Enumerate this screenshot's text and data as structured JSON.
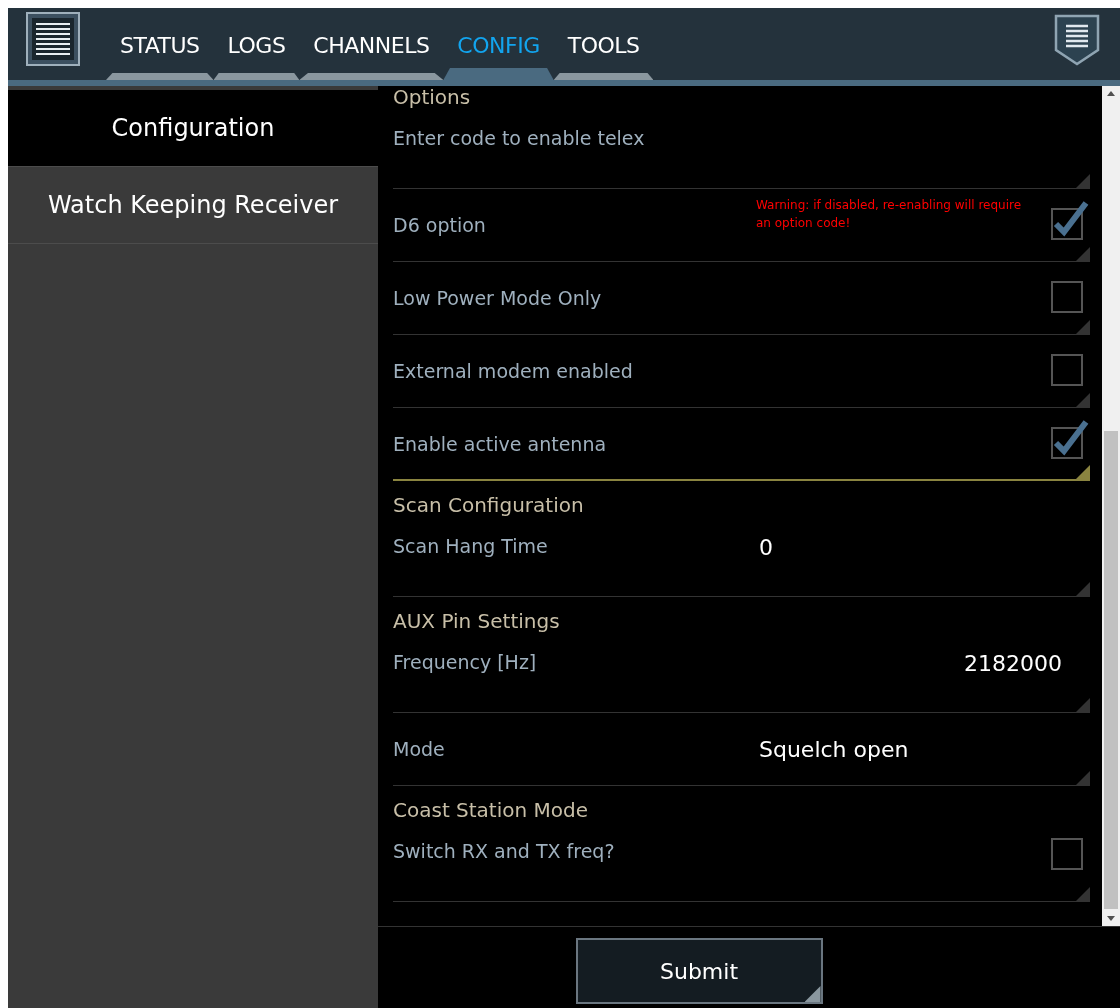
{
  "tabs": [
    {
      "label": "STATUS",
      "selected": false
    },
    {
      "label": "LOGS",
      "selected": false
    },
    {
      "label": "CHANNELS",
      "selected": false
    },
    {
      "label": "CONFIG",
      "selected": true
    },
    {
      "label": "TOOLS",
      "selected": false
    }
  ],
  "sidebar": {
    "items": [
      {
        "label": "Configuration",
        "selected": true
      },
      {
        "label": "Watch Keeping Receiver",
        "selected": false
      }
    ]
  },
  "rows": [
    {
      "kind": "section",
      "label": "Options"
    },
    {
      "kind": "input",
      "label": "Enter code to enable telex",
      "focused": false
    },
    {
      "kind": "checkbox",
      "label": "D6 option",
      "checked": true,
      "warning": "Warning: if disabled, re-enabling will require an option code!",
      "focused": false
    },
    {
      "kind": "checkbox",
      "label": "Low Power Mode Only",
      "checked": false,
      "focused": false
    },
    {
      "kind": "checkbox",
      "label": "External modem enabled",
      "checked": false,
      "focused": false
    },
    {
      "kind": "checkbox",
      "label": "Enable active antenna",
      "checked": true,
      "focused": true
    },
    {
      "kind": "section",
      "label": "Scan Configuration"
    },
    {
      "kind": "select",
      "label": "Scan Hang Time",
      "value": "0",
      "focused": false
    },
    {
      "kind": "section",
      "label": "AUX Pin Settings"
    },
    {
      "kind": "input",
      "label": "Frequency [Hz]",
      "value": "2182000",
      "focused": false
    },
    {
      "kind": "select",
      "label": "Mode",
      "value": "Squelch open",
      "focused": false
    },
    {
      "kind": "section",
      "label": "Coast Station Mode"
    },
    {
      "kind": "checkbox",
      "label": "Switch RX and TX freq?",
      "checked": false,
      "focused": false
    }
  ],
  "submit": {
    "label": "Submit"
  }
}
